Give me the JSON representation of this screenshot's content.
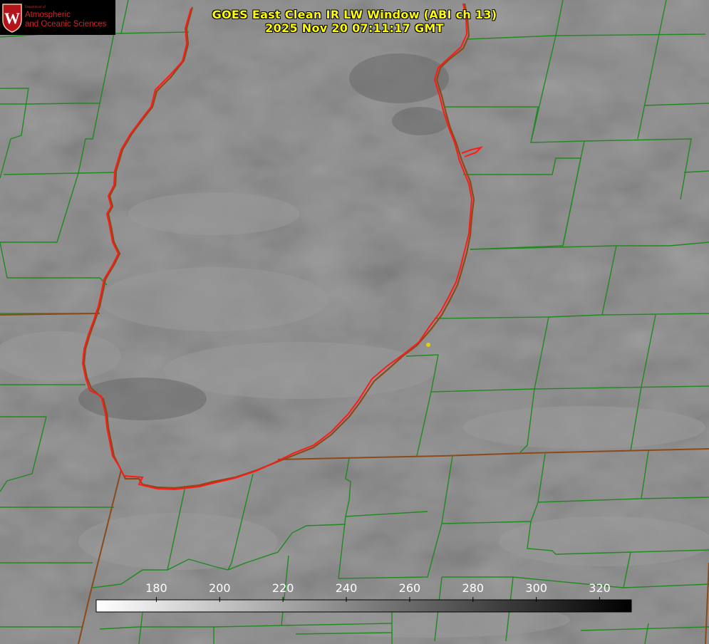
{
  "header": {
    "title_line_1": "GOES East Clean IR LW Window (ABI ch 13)",
    "title_line_2": "2025 Nov 20 07:11:17 GMT"
  },
  "logo": {
    "department": "Department of",
    "line_1": "Atmospheric",
    "line_2": "and Oceanic Sciences",
    "crest_letter": "W"
  },
  "colorbar": {
    "ticks": [
      180,
      200,
      220,
      240,
      260,
      280,
      300,
      320
    ],
    "min_value": 161,
    "max_value": 330,
    "gradient_start": "#ffffff",
    "gradient_end": "#000000"
  },
  "colors": {
    "title": "#ffff00",
    "county_lines": "#1f8a1f",
    "state_lines": "#8a4a1a",
    "shoreline": "#ff2020",
    "logo_text": "#d0242a",
    "marker": "#e0d400"
  },
  "map_features": {
    "lake": "lake-michigan-outline",
    "marker": "station-marker"
  }
}
